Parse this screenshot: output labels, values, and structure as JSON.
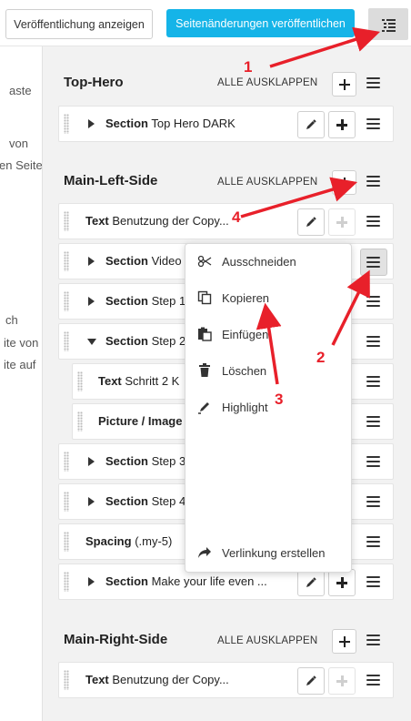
{
  "toolbar": {
    "show_publication_label": "Veröffentlichung anzeigen",
    "publish_changes_label": "Seitenänderungen veröffentlichen",
    "toggle_icon": "list-tree-icon"
  },
  "left_fragments": [
    "aste",
    "von",
    "en Seite",
    "ch",
    "ite von",
    "ite auf"
  ],
  "groups": {
    "top_hero": {
      "title": "Top-Hero",
      "expand_all": "ALLE AUSKLAPPEN"
    },
    "main_left": {
      "title": "Main-Left-Side",
      "expand_all": "ALLE AUSKLAPPEN"
    },
    "main_right": {
      "title": "Main-Right-Side",
      "expand_all": "ALLE AUSKLAPPEN"
    }
  },
  "rows": [
    {
      "kind": "Section",
      "label": "Top Hero DARK"
    },
    {
      "kind": "Text",
      "label": "Benutzung der Copy..."
    },
    {
      "kind": "Section",
      "label": "Video"
    },
    {
      "kind": "Section",
      "label": "Step 1"
    },
    {
      "kind": "Section",
      "label": "Step 2"
    },
    {
      "kind": "Text",
      "label": "Schritt 2 K"
    },
    {
      "kind": "Picture / Image",
      "label": ""
    },
    {
      "kind": "Section",
      "label": "Step 3"
    },
    {
      "kind": "Section",
      "label": "Step 4"
    },
    {
      "kind": "Spacing",
      "label": "(.my-5)"
    },
    {
      "kind": "Section",
      "label": "Make your life even ..."
    },
    {
      "kind": "Text",
      "label": "Benutzung der Copy..."
    }
  ],
  "context_menu": {
    "cut": "Ausschneiden",
    "copy": "Kopieren",
    "paste": "Einfügen",
    "delete": "Löschen",
    "highlight": "Highlight",
    "link": "Verlinkung erstellen"
  },
  "annotations": [
    "1",
    "2",
    "3",
    "4"
  ],
  "colors": {
    "primary": "#15b4e8",
    "annotation": "#e8202a",
    "panel_bg": "#f2f2f2"
  }
}
